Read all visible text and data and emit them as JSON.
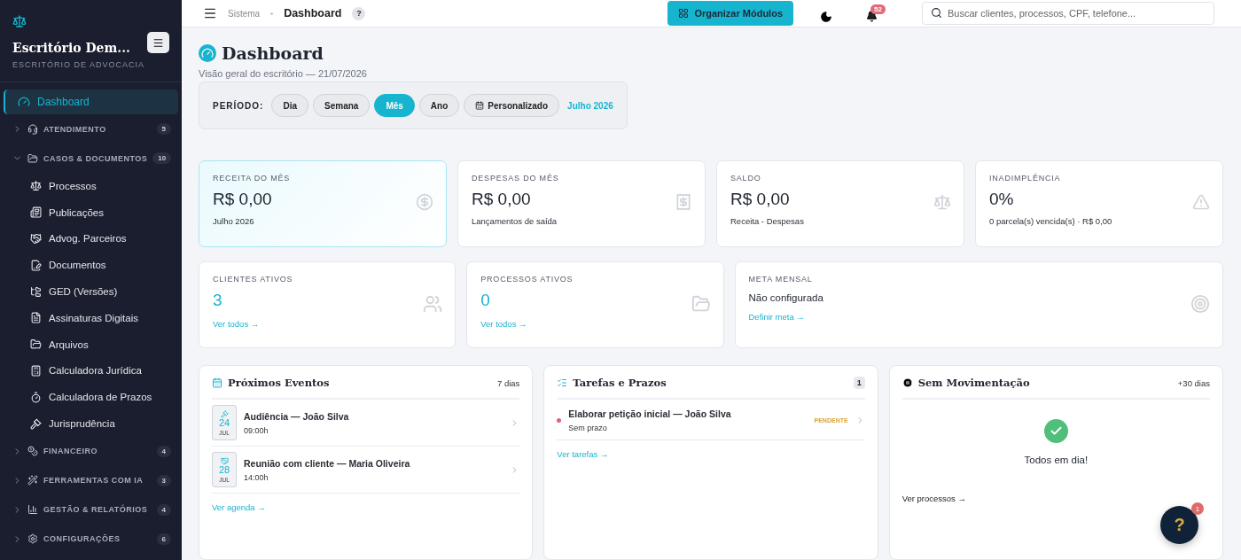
{
  "sidebar": {
    "brand": "Escritório Dem...",
    "subtitle": "ESCRITÓRIO DE ADVOCACIA",
    "items": [
      {
        "kind": "link",
        "label": "Dashboard",
        "selected": true
      },
      {
        "kind": "group",
        "label": "ATENDIMENTO",
        "count": "5",
        "expanded": false
      },
      {
        "kind": "group",
        "label": "CASOS & DOCUMENTOS",
        "count": "10",
        "expanded": true,
        "children": [
          {
            "label": "Processos",
            "selected": false
          },
          {
            "label": "Publicações",
            "selected": false
          },
          {
            "label": "Advog. Parceiros",
            "selected": false
          },
          {
            "label": "Documentos",
            "selected": false
          },
          {
            "label": "GED (Versões)",
            "selected": false
          },
          {
            "label": "Assinaturas Digitais",
            "selected": false
          },
          {
            "label": "Arquivos",
            "selected": false
          },
          {
            "label": "Calculadora Jurídica",
            "selected": false
          },
          {
            "label": "Calculadora de Prazos",
            "selected": false
          },
          {
            "label": "Jurisprudência",
            "selected": false
          }
        ]
      },
      {
        "kind": "group",
        "label": "FINANCEIRO",
        "count": "4",
        "expanded": false
      },
      {
        "kind": "group",
        "label": "FERRAMENTAS COM IA",
        "count": "3",
        "expanded": false
      },
      {
        "kind": "group",
        "label": "GESTÃO & RELATÓRIOS",
        "count": "4",
        "expanded": false
      },
      {
        "kind": "group",
        "label": "CONFIGURAÇÕES",
        "count": "6",
        "expanded": false
      }
    ]
  },
  "header": {
    "breadcrumb": [
      "Sistema",
      "Dashboard"
    ],
    "help": "?",
    "organize_button": "Organizar Módulos",
    "notifications": "52",
    "search": {
      "placeholder": "Buscar clientes, processos, CPF, telefone..."
    }
  },
  "page": {
    "title": "Dashboard",
    "subtitle": "Visão geral do escritório — 21/07/2026",
    "period": {
      "label": "PERÍODO:",
      "options": [
        {
          "label": "Dia",
          "selected": false
        },
        {
          "label": "Semana",
          "selected": false
        },
        {
          "label": "Mês",
          "selected": true
        },
        {
          "label": "Ano",
          "selected": false
        },
        {
          "label": "Personalizado",
          "selected": false,
          "kind": "custom"
        }
      ],
      "current": "Julho 2026"
    }
  },
  "stats_row_1": [
    {
      "label": "RECEITA DO MÊS",
      "value": "R$ 0,00",
      "note": "Julho 2026",
      "highlighted": true
    },
    {
      "label": "DESPESAS DO MÊS",
      "value": "R$ 0,00",
      "note": "Lançamentos de saída",
      "highlighted": false
    },
    {
      "label": "SALDO",
      "value": "R$ 0,00",
      "note": "Receita - Despesas",
      "highlighted": false
    },
    {
      "label": "INADIMPLÊNCIA",
      "value": "0%",
      "note": "0 parcela(s) vencida(s) · R$ 0,00",
      "highlighted": false
    }
  ],
  "stats_row_2": [
    {
      "label": "CLIENTES ATIVOS",
      "value": "3",
      "link": "Ver todos →",
      "kind": "count"
    },
    {
      "label": "PROCESSOS ATIVOS",
      "value": "0",
      "link": "Ver todos →",
      "kind": "count"
    },
    {
      "label": "META MENSAL",
      "value": "Não configurada",
      "link": "Definir meta →",
      "kind": "text"
    }
  ],
  "events": {
    "title": "Próximos Eventos",
    "range": "7 dias",
    "items": [
      {
        "day": "24",
        "month": "JUL",
        "title": "Audiência — João Silva",
        "time": "09:00h"
      },
      {
        "day": "28",
        "month": "JUL",
        "title": "Reunião com cliente — Maria Oliveira",
        "time": "14:00h"
      }
    ],
    "link": "Ver agenda →"
  },
  "tasks": {
    "title": "Tarefas e Prazos",
    "count": "1",
    "items": [
      {
        "title": "Elaborar petição inicial — João Silva",
        "due": "Sem prazo",
        "status": "PENDENTE",
        "color": "#e0607a"
      }
    ],
    "link": "Ver tarefas →"
  },
  "stale": {
    "title": "Sem Movimentação",
    "range": "+30 dias",
    "message": "Todos em dia!",
    "link": "Ver processos →"
  },
  "help_fab": {
    "label": "?",
    "badge": "1"
  }
}
